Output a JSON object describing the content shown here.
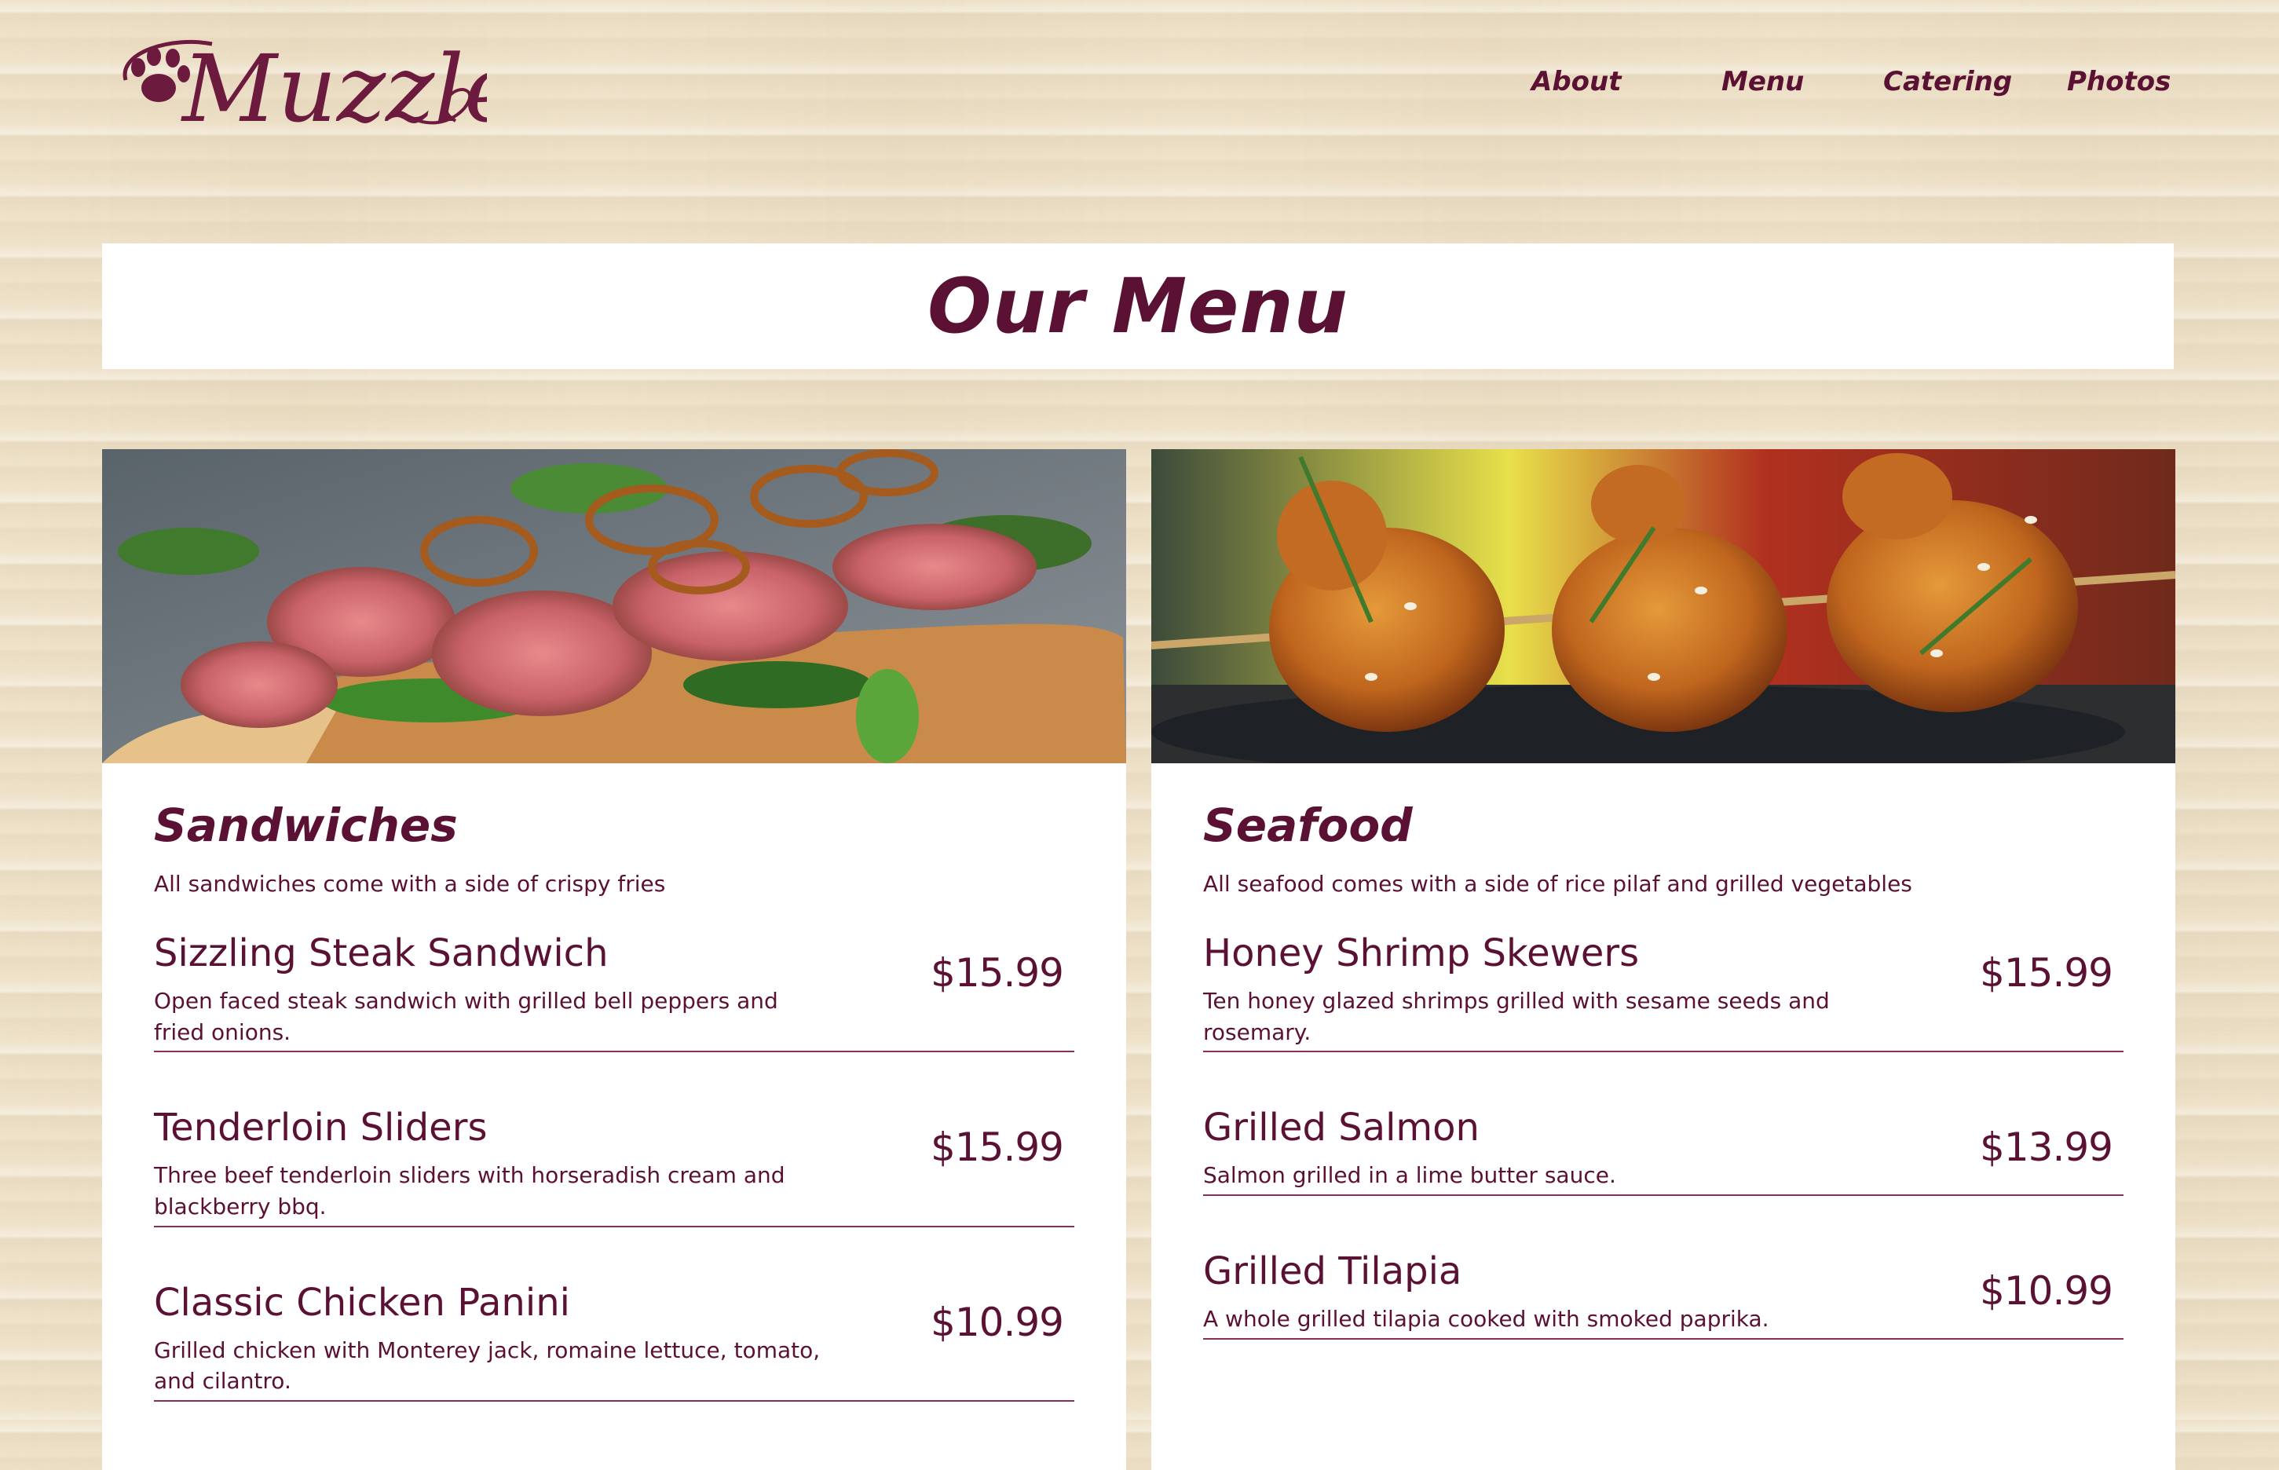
{
  "brand": {
    "name": "Muzzles"
  },
  "nav": {
    "items": [
      {
        "label": "About"
      },
      {
        "label": "Menu"
      },
      {
        "label": "Catering"
      },
      {
        "label": "Photos"
      }
    ]
  },
  "page": {
    "title": "Our Menu"
  },
  "colors": {
    "accent": "#5b1133",
    "divider": "#8a2d57",
    "background": "#efe3cb",
    "card": "#ffffff"
  },
  "sections": [
    {
      "title": "Sandwiches",
      "note": "All sandwiches come with a side of crispy fries",
      "image": "steak-sandwich-photo",
      "items": [
        {
          "name": "Sizzling Steak Sandwich",
          "desc": "Open faced steak sandwich with grilled bell peppers and fried onions.",
          "price": "$15.99"
        },
        {
          "name": "Tenderloin Sliders",
          "desc": "Three beef tenderloin sliders with horseradish cream and blackberry bbq.",
          "price": "$15.99"
        },
        {
          "name": "Classic Chicken Panini",
          "desc": "Grilled chicken with Monterey jack, romaine lettuce, tomato, and cilantro.",
          "price": "$10.99"
        }
      ]
    },
    {
      "title": "Seafood",
      "note": "All seafood comes with a side of rice pilaf and grilled vegetables",
      "image": "shrimp-skewers-photo",
      "items": [
        {
          "name": "Honey Shrimp Skewers",
          "desc": "Ten honey glazed shrimps grilled with sesame seeds and rosemary.",
          "price": "$15.99"
        },
        {
          "name": "Grilled Salmon",
          "desc": "Salmon grilled in a lime butter sauce.",
          "price": "$13.99"
        },
        {
          "name": "Grilled Tilapia",
          "desc": "A whole grilled tilapia cooked with smoked paprika.",
          "price": "$10.99"
        }
      ]
    }
  ]
}
